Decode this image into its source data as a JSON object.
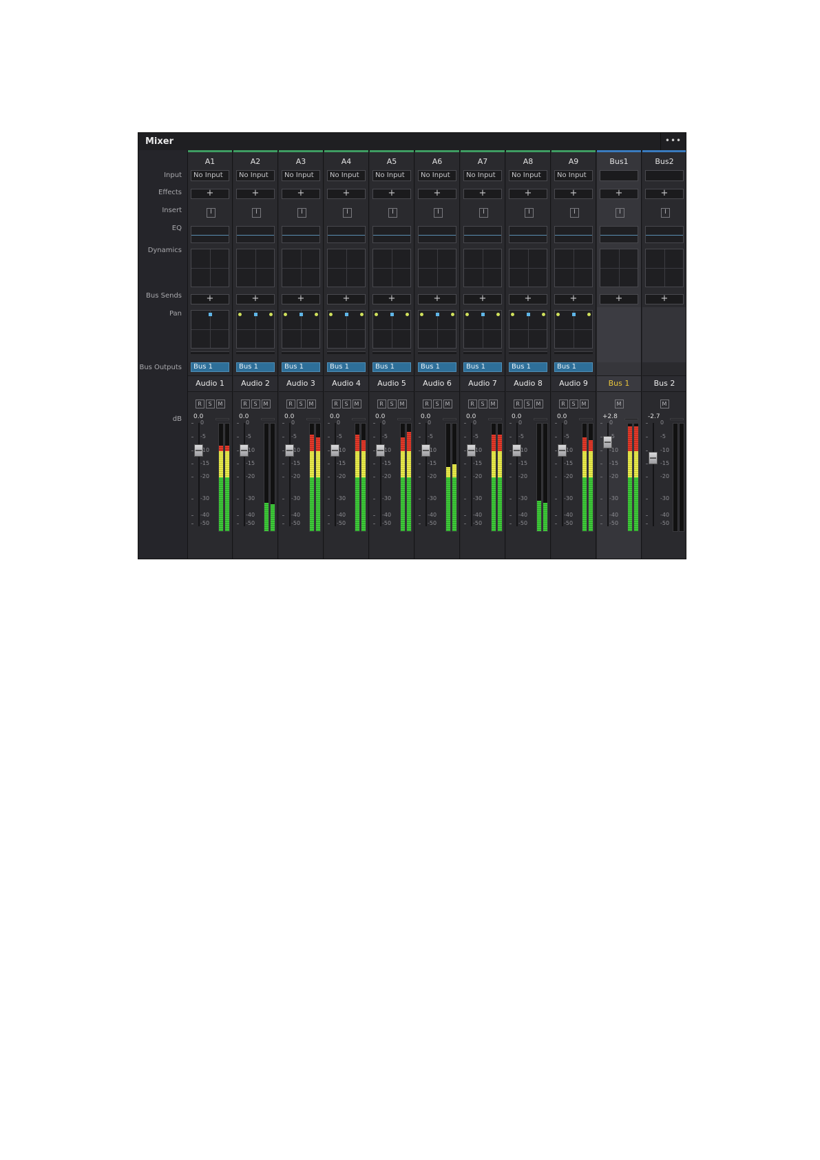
{
  "title": "Mixer",
  "menu": "•••",
  "row_labels": {
    "input": "Input",
    "effects": "Effects",
    "insert": "Insert",
    "eq": "EQ",
    "dynamics": "Dynamics",
    "bus_sends": "Bus Sends",
    "pan": "Pan",
    "bus_outputs": "Bus Outputs",
    "db": "dB"
  },
  "plus": "+",
  "insert_label": "I",
  "scale": [
    "0",
    "-5",
    "-10",
    "-15",
    "-20",
    "-30",
    "-40",
    "-50"
  ],
  "colors": {
    "track_accent": "#3e9d62",
    "bus_accent": "#3a7bbf",
    "selected_name": "#e9c53c",
    "bus_output": "#2e6f99"
  },
  "channels": [
    {
      "id": "A1",
      "input": "No Input",
      "bus_output": "Bus 1",
      "name": "Audio 1",
      "db": "0.0",
      "fader_db": -10,
      "meters": [
        -8,
        -8
      ],
      "buttons": [
        "R",
        "S",
        "M"
      ]
    },
    {
      "id": "A2",
      "input": "No Input",
      "bus_output": "Bus 1",
      "name": "Audio 2",
      "db": "0.0",
      "fader_db": -10,
      "meters": [
        -32,
        -33
      ],
      "buttons": [
        "R",
        "S",
        "M"
      ]
    },
    {
      "id": "A3",
      "input": "No Input",
      "bus_output": "Bus 1",
      "name": "Audio 3",
      "db": "0.0",
      "fader_db": -10,
      "meters": [
        -4,
        -5
      ],
      "buttons": [
        "R",
        "S",
        "M"
      ]
    },
    {
      "id": "A4",
      "input": "No Input",
      "bus_output": "Bus 1",
      "name": "Audio 4",
      "db": "0.0",
      "fader_db": -10,
      "meters": [
        -4,
        -6
      ],
      "buttons": [
        "R",
        "S",
        "M"
      ]
    },
    {
      "id": "A5",
      "input": "No Input",
      "bus_output": "Bus 1",
      "name": "Audio 5",
      "db": "0.0",
      "fader_db": -10,
      "meters": [
        -5,
        -3
      ],
      "buttons": [
        "R",
        "S",
        "M"
      ]
    },
    {
      "id": "A6",
      "input": "No Input",
      "bus_output": "Bus 1",
      "name": "Audio 6",
      "db": "0.0",
      "fader_db": -10,
      "meters": [
        -16,
        -15
      ],
      "buttons": [
        "R",
        "S",
        "M"
      ]
    },
    {
      "id": "A7",
      "input": "No Input",
      "bus_output": "Bus 1",
      "name": "Audio 7",
      "db": "0.0",
      "fader_db": -10,
      "meters": [
        -4,
        -4
      ],
      "buttons": [
        "R",
        "S",
        "M"
      ]
    },
    {
      "id": "A8",
      "input": "No Input",
      "bus_output": "Bus 1",
      "name": "Audio 8",
      "db": "0.0",
      "fader_db": -10,
      "meters": [
        -31,
        -32
      ],
      "buttons": [
        "R",
        "S",
        "M"
      ]
    },
    {
      "id": "A9",
      "input": "No Input",
      "bus_output": "Bus 1",
      "name": "Audio 9",
      "db": "0.0",
      "fader_db": -10,
      "meters": [
        -5,
        -6
      ],
      "buttons": [
        "R",
        "S",
        "M"
      ]
    },
    {
      "id": "Bus1",
      "input": "",
      "bus_output": "",
      "name": "Bus 1",
      "db": "+2.8",
      "fader_db": -7,
      "meters": [
        -1,
        -1
      ],
      "buttons": [
        "M"
      ],
      "selected": true,
      "bus": true
    },
    {
      "id": "Bus2",
      "input": "",
      "bus_output": "",
      "name": "Bus 2",
      "db": "-2.7",
      "fader_db": -13,
      "meters": [],
      "buttons": [
        "M"
      ],
      "bus": true
    }
  ]
}
